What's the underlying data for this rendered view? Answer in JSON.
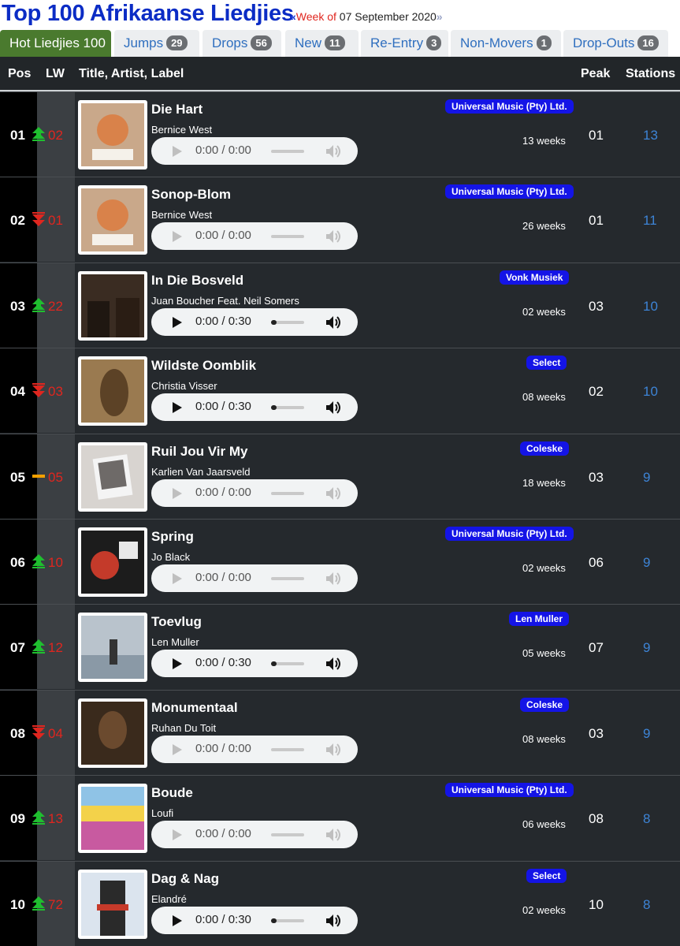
{
  "header": {
    "title": "Top 100 Afrikaanse Liedjies",
    "week_prev_arrow": "«",
    "week_label": "Week of",
    "week_date": "07 September 2020",
    "week_next_arrow": "»"
  },
  "tabs": [
    {
      "label": "Hot Liedjies 100",
      "count": ""
    },
    {
      "label": "Jumps",
      "count": "29"
    },
    {
      "label": "Drops",
      "count": "56"
    },
    {
      "label": "New",
      "count": "11"
    },
    {
      "label": "Re-Entry",
      "count": "3"
    },
    {
      "label": "Non-Movers",
      "count": "1"
    },
    {
      "label": "Drop-Outs",
      "count": "16"
    }
  ],
  "columns": {
    "pos": "Pos",
    "lw": "LW",
    "title": "Title, Artist, Label",
    "peak": "Peak",
    "stations": "Stations"
  },
  "colors": {
    "up": "#1fbf2f",
    "down": "#e0261f",
    "same": "#f2a000",
    "label_badge": "#1414e6",
    "stations_link": "#3d84d6"
  },
  "rows": [
    {
      "pos": "01",
      "lw": "02",
      "move": "up",
      "title": "Die Hart",
      "artist": "Bernice West",
      "label": "Universal Music (Pty) Ltd.",
      "time": "0:00 / 0:00",
      "player": "idle",
      "weeks": "13 weeks",
      "peak": "01",
      "stations": "13",
      "art": "bernice"
    },
    {
      "pos": "02",
      "lw": "01",
      "move": "down",
      "title": "Sonop-Blom",
      "artist": "Bernice West",
      "label": "Universal Music (Pty) Ltd.",
      "time": "0:00 / 0:00",
      "player": "idle",
      "weeks": "26 weeks",
      "peak": "01",
      "stations": "11",
      "art": "bernice"
    },
    {
      "pos": "03",
      "lw": "22",
      "move": "up",
      "title": "In Die Bosveld",
      "artist": "Juan Boucher Feat. Neil Somers",
      "label": "Vonk Musiek",
      "time": "0:00 / 0:30",
      "player": "ready",
      "weeks": "02 weeks",
      "peak": "03",
      "stations": "10",
      "art": "bosveld"
    },
    {
      "pos": "04",
      "lw": "03",
      "move": "down",
      "title": "Wildste Oomblik",
      "artist": "Christia Visser",
      "label": "Select",
      "time": "0:00 / 0:30",
      "player": "ready",
      "weeks": "08 weeks",
      "peak": "02",
      "stations": "10",
      "art": "christia"
    },
    {
      "pos": "05",
      "lw": "05",
      "move": "same",
      "title": "Ruil Jou Vir My",
      "artist": "Karlien Van Jaarsveld",
      "label": "Coleske",
      "time": "0:00 / 0:00",
      "player": "idle",
      "weeks": "18 weeks",
      "peak": "03",
      "stations": "9",
      "art": "karlien"
    },
    {
      "pos": "06",
      "lw": "10",
      "move": "up",
      "title": "Spring",
      "artist": "Jo Black",
      "label": "Universal Music (Pty) Ltd.",
      "time": "0:00 / 0:00",
      "player": "idle",
      "weeks": "02 weeks",
      "peak": "06",
      "stations": "9",
      "art": "joblack"
    },
    {
      "pos": "07",
      "lw": "12",
      "move": "up",
      "title": "Toevlug",
      "artist": "Len Muller",
      "label": "Len Muller",
      "time": "0:00 / 0:30",
      "player": "ready",
      "weeks": "05 weeks",
      "peak": "07",
      "stations": "9",
      "art": "len"
    },
    {
      "pos": "08",
      "lw": "04",
      "move": "down",
      "title": "Monumentaal",
      "artist": "Ruhan Du Toit",
      "label": "Coleske",
      "time": "0:00 / 0:00",
      "player": "idle",
      "weeks": "08 weeks",
      "peak": "03",
      "stations": "9",
      "art": "ruhan"
    },
    {
      "pos": "09",
      "lw": "13",
      "move": "up",
      "title": "Boude",
      "artist": "Loufi",
      "label": "Universal Music (Pty) Ltd.",
      "time": "0:00 / 0:00",
      "player": "idle",
      "weeks": "06 weeks",
      "peak": "08",
      "stations": "8",
      "art": "boude"
    },
    {
      "pos": "10",
      "lw": "72",
      "move": "up",
      "title": "Dag & Nag",
      "artist": "Elandré",
      "label": "Select",
      "time": "0:00 / 0:30",
      "player": "ready",
      "weeks": "02 weeks",
      "peak": "10",
      "stations": "8",
      "art": "elandre"
    }
  ]
}
